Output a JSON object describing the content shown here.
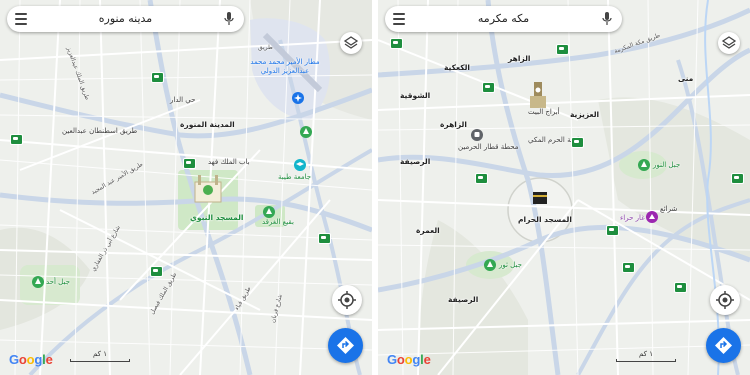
{
  "left_map": {
    "search_query": "مدينه منوره",
    "labels": {
      "airport": "مطار الأمير محمد محمد عبدالعزيز الدولي",
      "road_tariq": "طريق",
      "madinah": "المدينة المنورة",
      "nabawi": "المسجد النبوي",
      "bab_malik_fahd": "باب الملك فهد",
      "baqi": "بقيع الغرقد",
      "taibah_uni": "جامعة طيبة",
      "uhud": "جبل أحد",
      "hay_aldar": "حي الدار",
      "sultan_rd": "طريق اسطنطان عبدالعين",
      "road_1": "طريق الملك عبدالعزيز",
      "road_2": "طريق الأمير عبد المجيد",
      "road_3": "شارع أبي ذر الغفاري",
      "road_4": "طريق الملك فيصل",
      "road_5": "طريق قباء",
      "road_6": "شارع قربان"
    },
    "scale_label": "١ كم",
    "google": [
      "G",
      "o",
      "o",
      "g",
      "l",
      "e"
    ]
  },
  "right_map": {
    "search_query": "مكه مكرمه",
    "labels": {
      "makkah_rd": "طريق مكة المكرمة",
      "zaher": "الزاهر",
      "kakiya": "الكعكية",
      "shawqiya": "الشوقية",
      "zahra": "الزاهرة",
      "hejra": "الهجرة",
      "khalidiya": "العزيزية",
      "abraj": "أبراج البيت",
      "haram_library": "مكتبة الحرم المكي",
      "station": "محطة قطار الحرمين",
      "rusaifa": "الرصيفة",
      "umrah": "العمرة",
      "haram": "المسجد الحرام",
      "nour": "جبل النور",
      "hira": "غار حراء",
      "thawr": "جبل ثور",
      "mina": "منى",
      "sharaie": "شرائع",
      "shisha": "الرصيفة",
      "road_left": "طريق"
    },
    "scale_label": "١ كم",
    "google": [
      "G",
      "o",
      "o",
      "g",
      "l",
      "e"
    ]
  },
  "colors": {
    "map_bg": "#eef0ec",
    "road": "#ffffff",
    "highway": "#c9d6e8",
    "park": "#cfe8c6",
    "water": "#bcd6f5",
    "accent": "#1a73e8"
  },
  "icons": [
    "menu-icon",
    "mic-icon",
    "layers-icon",
    "my-location-icon",
    "directions-icon",
    "airport-icon",
    "mosque-icon",
    "park-pin-icon",
    "university-icon",
    "station-icon",
    "landmark-icon"
  ]
}
